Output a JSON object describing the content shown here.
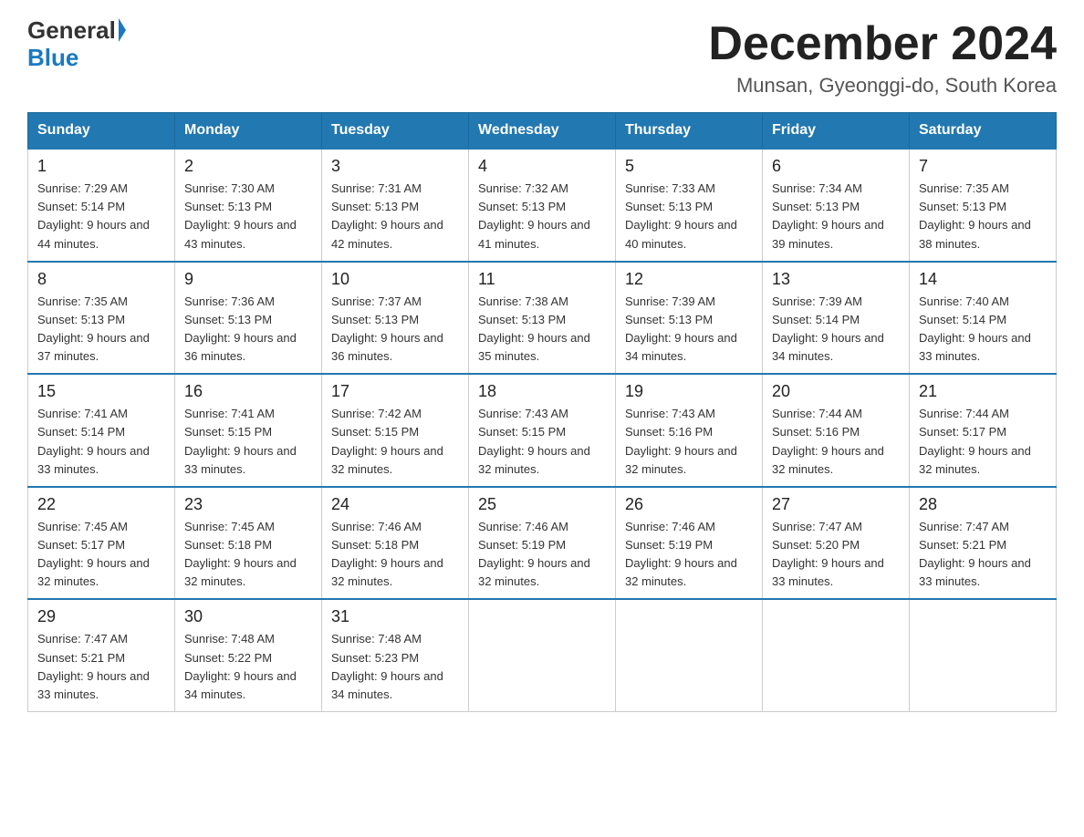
{
  "header": {
    "title": "December 2024",
    "subtitle": "Munsan, Gyeonggi-do, South Korea",
    "logo_general": "General",
    "logo_blue": "Blue"
  },
  "days_of_week": [
    "Sunday",
    "Monday",
    "Tuesday",
    "Wednesday",
    "Thursday",
    "Friday",
    "Saturday"
  ],
  "weeks": [
    [
      {
        "day": "1",
        "sunrise": "7:29 AM",
        "sunset": "5:14 PM",
        "daylight": "9 hours and 44 minutes."
      },
      {
        "day": "2",
        "sunrise": "7:30 AM",
        "sunset": "5:13 PM",
        "daylight": "9 hours and 43 minutes."
      },
      {
        "day": "3",
        "sunrise": "7:31 AM",
        "sunset": "5:13 PM",
        "daylight": "9 hours and 42 minutes."
      },
      {
        "day": "4",
        "sunrise": "7:32 AM",
        "sunset": "5:13 PM",
        "daylight": "9 hours and 41 minutes."
      },
      {
        "day": "5",
        "sunrise": "7:33 AM",
        "sunset": "5:13 PM",
        "daylight": "9 hours and 40 minutes."
      },
      {
        "day": "6",
        "sunrise": "7:34 AM",
        "sunset": "5:13 PM",
        "daylight": "9 hours and 39 minutes."
      },
      {
        "day": "7",
        "sunrise": "7:35 AM",
        "sunset": "5:13 PM",
        "daylight": "9 hours and 38 minutes."
      }
    ],
    [
      {
        "day": "8",
        "sunrise": "7:35 AM",
        "sunset": "5:13 PM",
        "daylight": "9 hours and 37 minutes."
      },
      {
        "day": "9",
        "sunrise": "7:36 AM",
        "sunset": "5:13 PM",
        "daylight": "9 hours and 36 minutes."
      },
      {
        "day": "10",
        "sunrise": "7:37 AM",
        "sunset": "5:13 PM",
        "daylight": "9 hours and 36 minutes."
      },
      {
        "day": "11",
        "sunrise": "7:38 AM",
        "sunset": "5:13 PM",
        "daylight": "9 hours and 35 minutes."
      },
      {
        "day": "12",
        "sunrise": "7:39 AM",
        "sunset": "5:13 PM",
        "daylight": "9 hours and 34 minutes."
      },
      {
        "day": "13",
        "sunrise": "7:39 AM",
        "sunset": "5:14 PM",
        "daylight": "9 hours and 34 minutes."
      },
      {
        "day": "14",
        "sunrise": "7:40 AM",
        "sunset": "5:14 PM",
        "daylight": "9 hours and 33 minutes."
      }
    ],
    [
      {
        "day": "15",
        "sunrise": "7:41 AM",
        "sunset": "5:14 PM",
        "daylight": "9 hours and 33 minutes."
      },
      {
        "day": "16",
        "sunrise": "7:41 AM",
        "sunset": "5:15 PM",
        "daylight": "9 hours and 33 minutes."
      },
      {
        "day": "17",
        "sunrise": "7:42 AM",
        "sunset": "5:15 PM",
        "daylight": "9 hours and 32 minutes."
      },
      {
        "day": "18",
        "sunrise": "7:43 AM",
        "sunset": "5:15 PM",
        "daylight": "9 hours and 32 minutes."
      },
      {
        "day": "19",
        "sunrise": "7:43 AM",
        "sunset": "5:16 PM",
        "daylight": "9 hours and 32 minutes."
      },
      {
        "day": "20",
        "sunrise": "7:44 AM",
        "sunset": "5:16 PM",
        "daylight": "9 hours and 32 minutes."
      },
      {
        "day": "21",
        "sunrise": "7:44 AM",
        "sunset": "5:17 PM",
        "daylight": "9 hours and 32 minutes."
      }
    ],
    [
      {
        "day": "22",
        "sunrise": "7:45 AM",
        "sunset": "5:17 PM",
        "daylight": "9 hours and 32 minutes."
      },
      {
        "day": "23",
        "sunrise": "7:45 AM",
        "sunset": "5:18 PM",
        "daylight": "9 hours and 32 minutes."
      },
      {
        "day": "24",
        "sunrise": "7:46 AM",
        "sunset": "5:18 PM",
        "daylight": "9 hours and 32 minutes."
      },
      {
        "day": "25",
        "sunrise": "7:46 AM",
        "sunset": "5:19 PM",
        "daylight": "9 hours and 32 minutes."
      },
      {
        "day": "26",
        "sunrise": "7:46 AM",
        "sunset": "5:19 PM",
        "daylight": "9 hours and 32 minutes."
      },
      {
        "day": "27",
        "sunrise": "7:47 AM",
        "sunset": "5:20 PM",
        "daylight": "9 hours and 33 minutes."
      },
      {
        "day": "28",
        "sunrise": "7:47 AM",
        "sunset": "5:21 PM",
        "daylight": "9 hours and 33 minutes."
      }
    ],
    [
      {
        "day": "29",
        "sunrise": "7:47 AM",
        "sunset": "5:21 PM",
        "daylight": "9 hours and 33 minutes."
      },
      {
        "day": "30",
        "sunrise": "7:48 AM",
        "sunset": "5:22 PM",
        "daylight": "9 hours and 34 minutes."
      },
      {
        "day": "31",
        "sunrise": "7:48 AM",
        "sunset": "5:23 PM",
        "daylight": "9 hours and 34 minutes."
      },
      null,
      null,
      null,
      null
    ]
  ]
}
